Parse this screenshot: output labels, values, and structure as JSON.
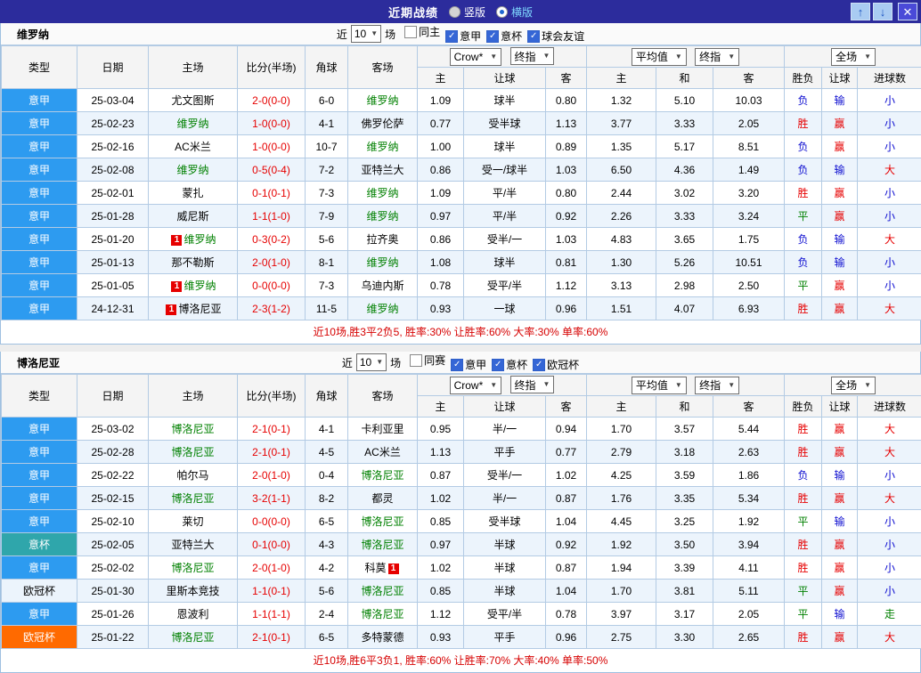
{
  "titlebar": {
    "title": "近期战绩",
    "layout_options": [
      {
        "label": "竖版",
        "selected": false
      },
      {
        "label": "横版",
        "selected": true
      }
    ]
  },
  "icons": {
    "dropdown": "▼",
    "up": "↑",
    "down": "↓",
    "close": "✕",
    "check": "✓"
  },
  "palette": {
    "c-win": "#e60000",
    "c-loss": "#0d0dd0",
    "c-draw": "#008000",
    "c-focal": "#008000",
    "c-score": "#e60000",
    "c-badge": "#e60000"
  },
  "type_styles": {
    "seriea": {
      "bg": "#2d9bf0",
      "fg": "#ffffff"
    },
    "coppa": {
      "bg": "#2fa6ab",
      "fg": "#ffffff"
    },
    "ucl": {
      "bg": "#ff6a00",
      "fg": "#ffffff"
    },
    "ucl_plain": {
      "bg": "",
      "fg": "#000000"
    }
  },
  "result_class_map": {
    "胜": "r-win",
    "赢": "r-win",
    "大": "r-win",
    "负": "r-loss",
    "输": "r-loss",
    "小": "r-loss",
    "平": "r-draw",
    "走": "r-draw"
  },
  "table_header": {
    "type": "类型",
    "date": "日期",
    "home": "主场",
    "score": "比分(半场)",
    "corner": "角球",
    "away": "客场",
    "bookmaker_dd": "Crow*",
    "stage_dd": "终指",
    "avg_dd": "平均值",
    "stage2_dd": "终指",
    "scope_dd": "全场",
    "sub": [
      "主",
      "让球",
      "客",
      "主",
      "和",
      "客",
      "胜负",
      "让球",
      "进球数"
    ]
  },
  "sections": [
    {
      "team": "维罗纳",
      "controls": {
        "near": "近",
        "count": "10",
        "games": "场",
        "filters": [
          {
            "label": "同主",
            "checked": false
          },
          {
            "label": "意甲",
            "checked": true
          },
          {
            "label": "意杯",
            "checked": true
          },
          {
            "label": "球会友谊",
            "checked": true
          }
        ]
      },
      "rows": [
        {
          "type": "意甲",
          "style": "seriea",
          "date": "25-03-04",
          "home": "尤文图斯",
          "hbadge": "",
          "hfocal": false,
          "score": "2-0(0-0)",
          "corner": "6-0",
          "away": "维罗纳",
          "abadge": "",
          "afocal": true,
          "odds": [
            "1.09",
            "球半",
            "0.80",
            "1.32",
            "5.10",
            "10.03"
          ],
          "results": [
            "负",
            "输",
            "小"
          ]
        },
        {
          "type": "意甲",
          "style": "seriea",
          "date": "25-02-23",
          "home": "维罗纳",
          "hbadge": "",
          "hfocal": true,
          "score": "1-0(0-0)",
          "corner": "4-1",
          "away": "佛罗伦萨",
          "abadge": "",
          "afocal": false,
          "odds": [
            "0.77",
            "受半球",
            "1.13",
            "3.77",
            "3.33",
            "2.05"
          ],
          "results": [
            "胜",
            "赢",
            "小"
          ]
        },
        {
          "type": "意甲",
          "style": "seriea",
          "date": "25-02-16",
          "home": "AC米兰",
          "hbadge": "",
          "hfocal": false,
          "score": "1-0(0-0)",
          "corner": "10-7",
          "away": "维罗纳",
          "abadge": "",
          "afocal": true,
          "odds": [
            "1.00",
            "球半",
            "0.89",
            "1.35",
            "5.17",
            "8.51"
          ],
          "results": [
            "负",
            "赢",
            "小"
          ]
        },
        {
          "type": "意甲",
          "style": "seriea",
          "date": "25-02-08",
          "home": "维罗纳",
          "hbadge": "",
          "hfocal": true,
          "score": "0-5(0-4)",
          "corner": "7-2",
          "away": "亚特兰大",
          "abadge": "",
          "afocal": false,
          "odds": [
            "0.86",
            "受一/球半",
            "1.03",
            "6.50",
            "4.36",
            "1.49"
          ],
          "results": [
            "负",
            "输",
            "大"
          ]
        },
        {
          "type": "意甲",
          "style": "seriea",
          "date": "25-02-01",
          "home": "蒙扎",
          "hbadge": "",
          "hfocal": false,
          "score": "0-1(0-1)",
          "corner": "7-3",
          "away": "维罗纳",
          "abadge": "",
          "afocal": true,
          "odds": [
            "1.09",
            "平/半",
            "0.80",
            "2.44",
            "3.02",
            "3.20"
          ],
          "results": [
            "胜",
            "赢",
            "小"
          ]
        },
        {
          "type": "意甲",
          "style": "seriea",
          "date": "25-01-28",
          "home": "威尼斯",
          "hbadge": "",
          "hfocal": false,
          "score": "1-1(1-0)",
          "corner": "7-9",
          "away": "维罗纳",
          "abadge": "",
          "afocal": true,
          "odds": [
            "0.97",
            "平/半",
            "0.92",
            "2.26",
            "3.33",
            "3.24"
          ],
          "results": [
            "平",
            "赢",
            "小"
          ]
        },
        {
          "type": "意甲",
          "style": "seriea",
          "date": "25-01-20",
          "home": "维罗纳",
          "hbadge": "1",
          "hfocal": true,
          "score": "0-3(0-2)",
          "corner": "5-6",
          "away": "拉齐奥",
          "abadge": "",
          "afocal": false,
          "odds": [
            "0.86",
            "受半/一",
            "1.03",
            "4.83",
            "3.65",
            "1.75"
          ],
          "results": [
            "负",
            "输",
            "大"
          ]
        },
        {
          "type": "意甲",
          "style": "seriea",
          "date": "25-01-13",
          "home": "那不勒斯",
          "hbadge": "",
          "hfocal": false,
          "score": "2-0(1-0)",
          "corner": "8-1",
          "away": "维罗纳",
          "abadge": "",
          "afocal": true,
          "odds": [
            "1.08",
            "球半",
            "0.81",
            "1.30",
            "5.26",
            "10.51"
          ],
          "results": [
            "负",
            "输",
            "小"
          ]
        },
        {
          "type": "意甲",
          "style": "seriea",
          "date": "25-01-05",
          "home": "维罗纳",
          "hbadge": "1",
          "hfocal": true,
          "score": "0-0(0-0)",
          "corner": "7-3",
          "away": "乌迪内斯",
          "abadge": "",
          "afocal": false,
          "odds": [
            "0.78",
            "受平/半",
            "1.12",
            "3.13",
            "2.98",
            "2.50"
          ],
          "results": [
            "平",
            "赢",
            "小"
          ]
        },
        {
          "type": "意甲",
          "style": "seriea",
          "date": "24-12-31",
          "home": "博洛尼亚",
          "hbadge": "1",
          "hfocal": false,
          "score": "2-3(1-2)",
          "corner": "11-5",
          "away": "维罗纳",
          "abadge": "",
          "afocal": true,
          "odds": [
            "0.93",
            "一球",
            "0.96",
            "1.51",
            "4.07",
            "6.93"
          ],
          "results": [
            "胜",
            "赢",
            "大"
          ]
        }
      ],
      "footer": "近10场,胜3平2负5, 胜率:30% 让胜率:60% 大率:30% 单率:60%"
    },
    {
      "team": "博洛尼亚",
      "controls": {
        "near": "近",
        "count": "10",
        "games": "场",
        "filters": [
          {
            "label": "同赛",
            "checked": false
          },
          {
            "label": "意甲",
            "checked": true
          },
          {
            "label": "意杯",
            "checked": true
          },
          {
            "label": "欧冠杯",
            "checked": true
          }
        ]
      },
      "rows": [
        {
          "type": "意甲",
          "style": "seriea",
          "date": "25-03-02",
          "home": "博洛尼亚",
          "hbadge": "",
          "hfocal": true,
          "score": "2-1(0-1)",
          "corner": "4-1",
          "away": "卡利亚里",
          "abadge": "",
          "afocal": false,
          "odds": [
            "0.95",
            "半/一",
            "0.94",
            "1.70",
            "3.57",
            "5.44"
          ],
          "results": [
            "胜",
            "赢",
            "大"
          ]
        },
        {
          "type": "意甲",
          "style": "seriea",
          "date": "25-02-28",
          "home": "博洛尼亚",
          "hbadge": "",
          "hfocal": true,
          "score": "2-1(0-1)",
          "corner": "4-5",
          "away": "AC米兰",
          "abadge": "",
          "afocal": false,
          "odds": [
            "1.13",
            "平手",
            "0.77",
            "2.79",
            "3.18",
            "2.63"
          ],
          "results": [
            "胜",
            "赢",
            "大"
          ]
        },
        {
          "type": "意甲",
          "style": "seriea",
          "date": "25-02-22",
          "home": "帕尔马",
          "hbadge": "",
          "hfocal": false,
          "score": "2-0(1-0)",
          "corner": "0-4",
          "away": "博洛尼亚",
          "abadge": "",
          "afocal": true,
          "odds": [
            "0.87",
            "受半/一",
            "1.02",
            "4.25",
            "3.59",
            "1.86"
          ],
          "results": [
            "负",
            "输",
            "小"
          ]
        },
        {
          "type": "意甲",
          "style": "seriea",
          "date": "25-02-15",
          "home": "博洛尼亚",
          "hbadge": "",
          "hfocal": true,
          "score": "3-2(1-1)",
          "corner": "8-2",
          "away": "都灵",
          "abadge": "",
          "afocal": false,
          "odds": [
            "1.02",
            "半/一",
            "0.87",
            "1.76",
            "3.35",
            "5.34"
          ],
          "results": [
            "胜",
            "赢",
            "大"
          ]
        },
        {
          "type": "意甲",
          "style": "seriea",
          "date": "25-02-10",
          "home": "莱切",
          "hbadge": "",
          "hfocal": false,
          "score": "0-0(0-0)",
          "corner": "6-5",
          "away": "博洛尼亚",
          "abadge": "",
          "afocal": true,
          "odds": [
            "0.85",
            "受半球",
            "1.04",
            "4.45",
            "3.25",
            "1.92"
          ],
          "results": [
            "平",
            "输",
            "小"
          ]
        },
        {
          "type": "意杯",
          "style": "coppa",
          "date": "25-02-05",
          "home": "亚特兰大",
          "hbadge": "",
          "hfocal": false,
          "score": "0-1(0-0)",
          "corner": "4-3",
          "away": "博洛尼亚",
          "abadge": "",
          "afocal": true,
          "odds": [
            "0.97",
            "半球",
            "0.92",
            "1.92",
            "3.50",
            "3.94"
          ],
          "results": [
            "胜",
            "赢",
            "小"
          ]
        },
        {
          "type": "意甲",
          "style": "seriea",
          "date": "25-02-02",
          "home": "博洛尼亚",
          "hbadge": "",
          "hfocal": true,
          "score": "2-0(1-0)",
          "corner": "4-2",
          "away": "科莫",
          "abadge": "1",
          "afocal": false,
          "odds": [
            "1.02",
            "半球",
            "0.87",
            "1.94",
            "3.39",
            "4.11"
          ],
          "results": [
            "胜",
            "赢",
            "小"
          ]
        },
        {
          "type": "欧冠杯",
          "style": "ucl_plain",
          "date": "25-01-30",
          "home": "里斯本竞技",
          "hbadge": "",
          "hfocal": false,
          "score": "1-1(0-1)",
          "corner": "5-6",
          "away": "博洛尼亚",
          "abadge": "",
          "afocal": true,
          "odds": [
            "0.85",
            "半球",
            "1.04",
            "1.70",
            "3.81",
            "5.11"
          ],
          "results": [
            "平",
            "赢",
            "小"
          ]
        },
        {
          "type": "意甲",
          "style": "seriea",
          "date": "25-01-26",
          "home": "恩波利",
          "hbadge": "",
          "hfocal": false,
          "score": "1-1(1-1)",
          "corner": "2-4",
          "away": "博洛尼亚",
          "abadge": "",
          "afocal": true,
          "odds": [
            "1.12",
            "受平/半",
            "0.78",
            "3.97",
            "3.17",
            "2.05"
          ],
          "results": [
            "平",
            "输",
            "走"
          ]
        },
        {
          "type": "欧冠杯",
          "style": "ucl",
          "date": "25-01-22",
          "home": "博洛尼亚",
          "hbadge": "",
          "hfocal": true,
          "score": "2-1(0-1)",
          "corner": "6-5",
          "away": "多特蒙德",
          "abadge": "",
          "afocal": false,
          "odds": [
            "0.93",
            "平手",
            "0.96",
            "2.75",
            "3.30",
            "2.65"
          ],
          "results": [
            "胜",
            "赢",
            "大"
          ]
        }
      ],
      "footer": "近10场,胜6平3负1, 胜率:60% 让胜率:70% 大率:40% 单率:50%"
    }
  ]
}
